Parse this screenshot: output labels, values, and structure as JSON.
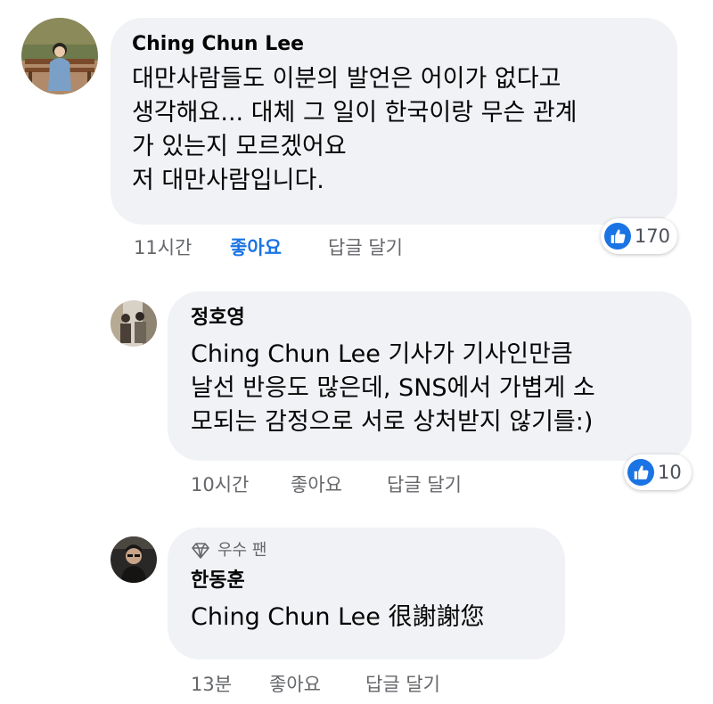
{
  "comments": [
    {
      "author": "Ching Chun Lee",
      "text_lines": [
        "대만사람들도 이분의 발언은 어이가 없다고",
        "생각해요... 대체 그 일이 한국이랑 무슨 관계",
        "가 있는지 모르겠어요",
        "저 대만사람입니다."
      ],
      "time": "11시간",
      "like_label": "좋아요",
      "reply_label": "답글 달기",
      "reaction_count": "170",
      "like_active": true
    },
    {
      "author": "정호영",
      "text_lines": [
        "Ching Chun Lee 기사가 기사인만큼",
        "날선 반응도 많은데, SNS에서 가볍게 소",
        "모되는 감정으로 서로 상처받지 않기를:)"
      ],
      "time": "10시간",
      "like_label": "좋아요",
      "reply_label": "답글 달기",
      "reaction_count": "10",
      "like_active": false
    },
    {
      "badge": {
        "icon": "diamond-icon",
        "label": "우수 팬"
      },
      "author": "한동훈",
      "text_lines": [
        "Ching Chun Lee 很謝謝您"
      ],
      "time": "13분",
      "like_label": "좋아요",
      "reply_label": "답글 달기",
      "like_active": false
    }
  ],
  "colors": {
    "bubble": "#f0f2f5",
    "meta_text": "#65676b",
    "like_blue": "#1b74e4"
  }
}
